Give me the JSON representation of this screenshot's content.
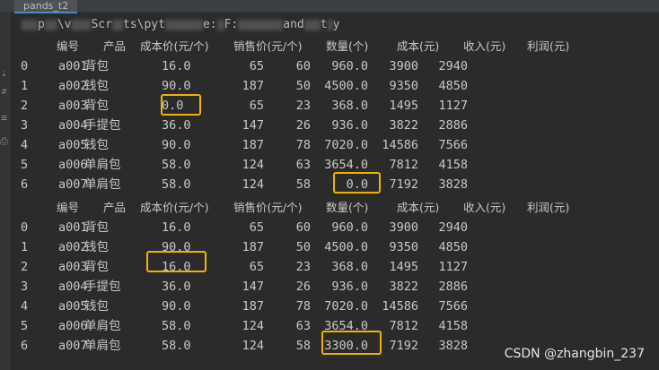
{
  "tab": {
    "label": "pands_t2"
  },
  "console": {
    "path_fragments": [
      "p",
      "\\v",
      "Scr",
      "ts\\pyt",
      "e:",
      "F:",
      "and",
      "t",
      "y"
    ]
  },
  "gutter_icons": [
    "⇣",
    "⇵",
    "≡",
    "⎙"
  ],
  "tables": [
    {
      "columns": [
        "编号",
        "产品",
        "成本价(元/个)",
        "销售价(元/个)",
        "数量(个)",
        "成本(元)",
        "收入(元)",
        "利润(元)"
      ],
      "rows": [
        {
          "index": "0",
          "id": "a001",
          "product": "背包",
          "cost": "16.0",
          "price": "65",
          "qty": "60",
          "total_cost": "960.0",
          "income": "3900",
          "profit": "2940"
        },
        {
          "index": "1",
          "id": "a002",
          "product": "钱包",
          "cost": "90.0",
          "price": "187",
          "qty": "50",
          "total_cost": "4500.0",
          "income": "9350",
          "profit": "4850"
        },
        {
          "index": "2",
          "id": "a003",
          "product": "背包",
          "cost": "0.0",
          "price": "65",
          "qty": "23",
          "total_cost": "368.0",
          "income": "1495",
          "profit": "1127"
        },
        {
          "index": "3",
          "id": "a004",
          "product": "手提包",
          "cost": "36.0",
          "price": "147",
          "qty": "26",
          "total_cost": "936.0",
          "income": "3822",
          "profit": "2886"
        },
        {
          "index": "4",
          "id": "a005",
          "product": "钱包",
          "cost": "90.0",
          "price": "187",
          "qty": "78",
          "total_cost": "7020.0",
          "income": "14586",
          "profit": "7566"
        },
        {
          "index": "5",
          "id": "a006",
          "product": "单肩包",
          "cost": "58.0",
          "price": "124",
          "qty": "63",
          "total_cost": "3654.0",
          "income": "7812",
          "profit": "4158"
        },
        {
          "index": "6",
          "id": "a007",
          "product": "单肩包",
          "cost": "58.0",
          "price": "124",
          "qty": "58",
          "total_cost": "0.0",
          "income": "7192",
          "profit": "3828"
        }
      ]
    },
    {
      "columns": [
        "编号",
        "产品",
        "成本价(元/个)",
        "销售价(元/个)",
        "数量(个)",
        "成本(元)",
        "收入(元)",
        "利润(元)"
      ],
      "rows": [
        {
          "index": "0",
          "id": "a001",
          "product": "背包",
          "cost": "16.0",
          "price": "65",
          "qty": "60",
          "total_cost": "960.0",
          "income": "3900",
          "profit": "2940"
        },
        {
          "index": "1",
          "id": "a002",
          "product": "钱包",
          "cost": "90.0",
          "price": "187",
          "qty": "50",
          "total_cost": "4500.0",
          "income": "9350",
          "profit": "4850"
        },
        {
          "index": "2",
          "id": "a003",
          "product": "背包",
          "cost": "16.0",
          "price": "65",
          "qty": "23",
          "total_cost": "368.0",
          "income": "1495",
          "profit": "1127"
        },
        {
          "index": "3",
          "id": "a004",
          "product": "手提包",
          "cost": "36.0",
          "price": "147",
          "qty": "26",
          "total_cost": "936.0",
          "income": "3822",
          "profit": "2886"
        },
        {
          "index": "4",
          "id": "a005",
          "product": "钱包",
          "cost": "90.0",
          "price": "187",
          "qty": "78",
          "total_cost": "7020.0",
          "income": "14586",
          "profit": "7566"
        },
        {
          "index": "5",
          "id": "a006",
          "product": "单肩包",
          "cost": "58.0",
          "price": "124",
          "qty": "63",
          "total_cost": "3654.0",
          "income": "7812",
          "profit": "4158"
        },
        {
          "index": "6",
          "id": "a007",
          "product": "单肩包",
          "cost": "58.0",
          "price": "124",
          "qty": "58",
          "total_cost": "3300.0",
          "income": "7192",
          "profit": "3828"
        }
      ]
    }
  ],
  "highlight_color": "#f0b400",
  "watermark": "CSDN @zhangbin_237"
}
